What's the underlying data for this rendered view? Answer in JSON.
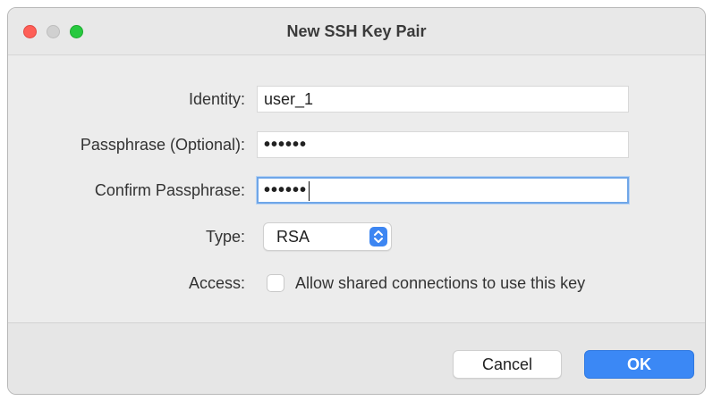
{
  "window": {
    "title": "New SSH Key Pair",
    "traffic_lights": [
      "close",
      "minimize",
      "zoom"
    ]
  },
  "form": {
    "identity": {
      "label": "Identity:",
      "value": "user_1"
    },
    "passphrase": {
      "label": "Passphrase (Optional):",
      "value": "••••••"
    },
    "confirm_passphrase": {
      "label": "Confirm Passphrase:",
      "value": "••••••",
      "focused": true
    },
    "type": {
      "label": "Type:",
      "selected": "RSA",
      "icon": "chevron-up-down-icon"
    },
    "access": {
      "label": "Access:",
      "checkbox_label": "Allow shared connections to use this key",
      "checked": false
    }
  },
  "buttons": {
    "cancel_label": "Cancel",
    "ok_label": "OK"
  },
  "colors": {
    "accent": "#3b88f5",
    "close": "#fe5f57",
    "zoom": "#27c93f",
    "focus_ring": "#6fa6e8"
  }
}
